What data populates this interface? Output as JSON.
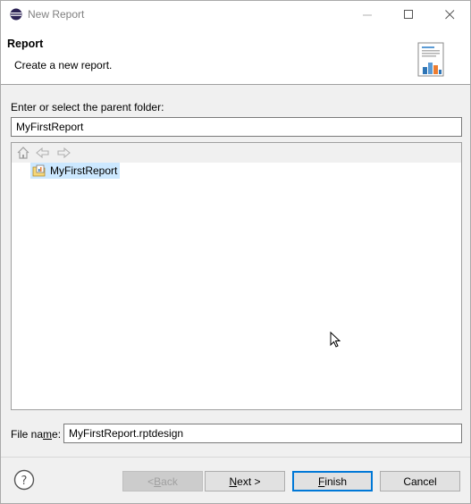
{
  "window": {
    "title": "New Report",
    "icon": "eclipse-icon"
  },
  "header": {
    "title": "Report",
    "description": "Create a new report."
  },
  "folder": {
    "label": "Enter or select the parent folder:",
    "value": "MyFirstReport"
  },
  "tree": {
    "toolbar_icons": [
      "home-icon",
      "back-arrow-icon",
      "forward-arrow-icon"
    ],
    "items": [
      {
        "label": "MyFirstReport",
        "icon": "report-project-icon",
        "selected": true
      }
    ]
  },
  "filename": {
    "label": "File name:",
    "value": "MyFirstReport.rptdesign"
  },
  "buttons": {
    "back": "< Back",
    "next": "Next >",
    "finish": "Finish",
    "cancel": "Cancel"
  },
  "colors": {
    "selection": "#cce8ff",
    "default_button_border": "#0078d7",
    "header_bg": "#ffffff",
    "dialog_bg": "#f0f0f0"
  }
}
